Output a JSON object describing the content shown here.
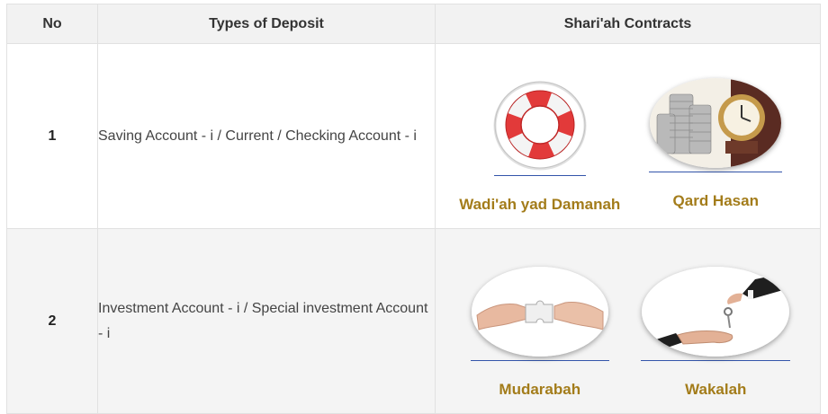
{
  "table": {
    "headers": [
      "No",
      "Types of Deposit",
      "Shari'ah Contracts"
    ],
    "rows": [
      {
        "no": "1",
        "type": "Saving Account - i / Current / Checking Account - i",
        "contracts": [
          {
            "label": "Wadi'ah yad Damanah",
            "icon": "lifebuoy-image"
          },
          {
            "label": "Qard Hasan",
            "icon": "coins-clock-image"
          }
        ]
      },
      {
        "no": "2",
        "type": "Investment Account - i / Special investment Account - i",
        "contracts": [
          {
            "label": "Mudarabah",
            "icon": "puzzle-hands-image"
          },
          {
            "label": "Wakalah",
            "icon": "key-handover-image"
          }
        ]
      }
    ]
  },
  "colors": {
    "header_bg": "#f2f2f2",
    "contract_label": "#a37c1a",
    "underline": "#3355aa",
    "row_alt_bg": "#f4f4f4"
  }
}
